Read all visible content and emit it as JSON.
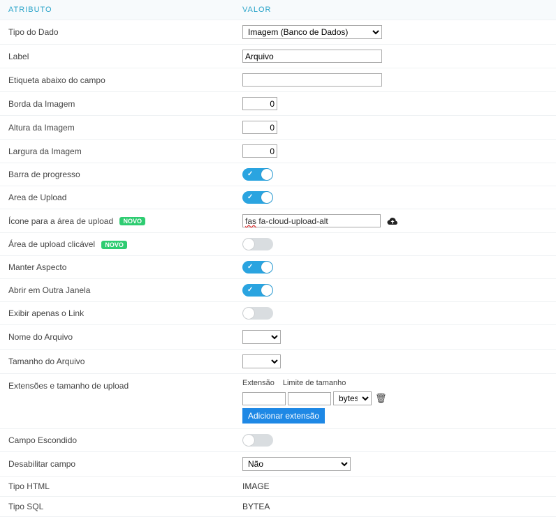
{
  "headers": {
    "attr": "ATRIBUTO",
    "val": "VALOR"
  },
  "rows": {
    "tipoDado": {
      "label": "Tipo do Dado",
      "value": "Imagem (Banco de Dados)"
    },
    "label": {
      "label": "Label",
      "value": "Arquivo"
    },
    "etiqueta": {
      "label": "Etiqueta abaixo do campo",
      "value": ""
    },
    "borda": {
      "label": "Borda da Imagem",
      "value": "0"
    },
    "altura": {
      "label": "Altura da Imagem",
      "value": "0"
    },
    "largura": {
      "label": "Largura da Imagem",
      "value": "0"
    },
    "barra": {
      "label": "Barra de progresso",
      "on": true
    },
    "areaUp": {
      "label": "Area de Upload",
      "on": true
    },
    "iconeUp": {
      "label": "Ícone para a área de upload",
      "novo": "NOVO",
      "value_pre": "fas",
      "value_rest": " fa-cloud-upload-alt"
    },
    "clicavel": {
      "label": "Área de upload clicável",
      "novo": "NOVO",
      "on": false
    },
    "aspecto": {
      "label": "Manter Aspecto",
      "on": true
    },
    "abrir": {
      "label": "Abrir em Outra Janela",
      "on": true
    },
    "exibirLink": {
      "label": "Exibir apenas o Link",
      "on": false
    },
    "nomeArq": {
      "label": "Nome do Arquivo",
      "value": ""
    },
    "tamArq": {
      "label": "Tamanho do Arquivo",
      "value": ""
    },
    "ext": {
      "label": "Extensões e tamanho de upload",
      "sub1": "Extensão",
      "sub2": "Limite de tamanho",
      "unit": "bytes",
      "addBtn": "Adicionar extensão"
    },
    "escondido": {
      "label": "Campo Escondido",
      "on": false
    },
    "desab": {
      "label": "Desabilitar campo",
      "value": "Não"
    },
    "tipoHtml": {
      "label": "Tipo HTML",
      "value": "IMAGE"
    },
    "tipoSql": {
      "label": "Tipo SQL",
      "value": "BYTEA"
    }
  }
}
